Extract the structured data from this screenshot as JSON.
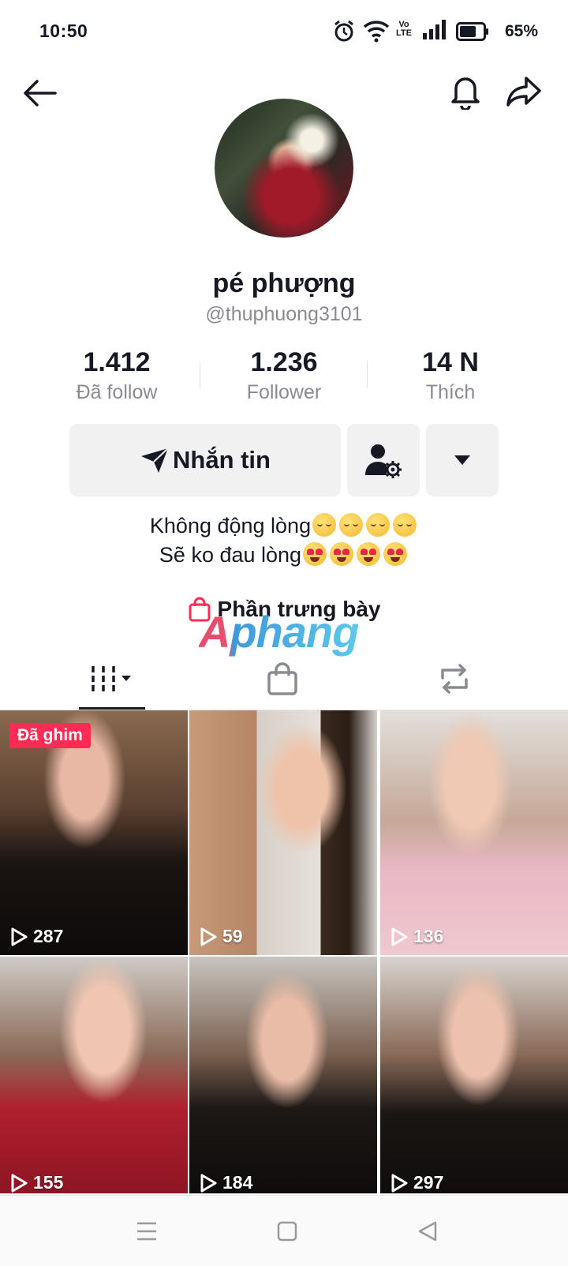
{
  "status_bar": {
    "time": "10:50",
    "volte": "Vo\nLTE",
    "battery": "65%"
  },
  "header": {
    "back_icon": "arrow-left-icon",
    "bell_icon": "bell-icon",
    "share_icon": "share-arrow-icon"
  },
  "profile": {
    "display_name": "pé phượng",
    "handle": "@thuphuong3101"
  },
  "stats": [
    {
      "value": "1.412",
      "label": "Đã follow"
    },
    {
      "value": "1.236",
      "label": "Follower"
    },
    {
      "value": "14 N",
      "label": "Thích"
    }
  ],
  "actions": {
    "message_label": "Nhắn tin"
  },
  "bio": {
    "line1": "Không động lòng",
    "line2": "Sẽ ko đau lòng"
  },
  "showcase": {
    "label": "Phần trưng bày"
  },
  "watermark": "Aphang",
  "videos": [
    {
      "views": "287",
      "pinned_label": "Đã ghim"
    },
    {
      "views": "59"
    },
    {
      "views": "136"
    },
    {
      "views": "155"
    },
    {
      "views": "184"
    },
    {
      "views": "297"
    }
  ],
  "colors": {
    "accent": "#fe2c55",
    "text": "#161823",
    "muted": "#8a8b91",
    "button_bg": "#f1f1f2"
  }
}
